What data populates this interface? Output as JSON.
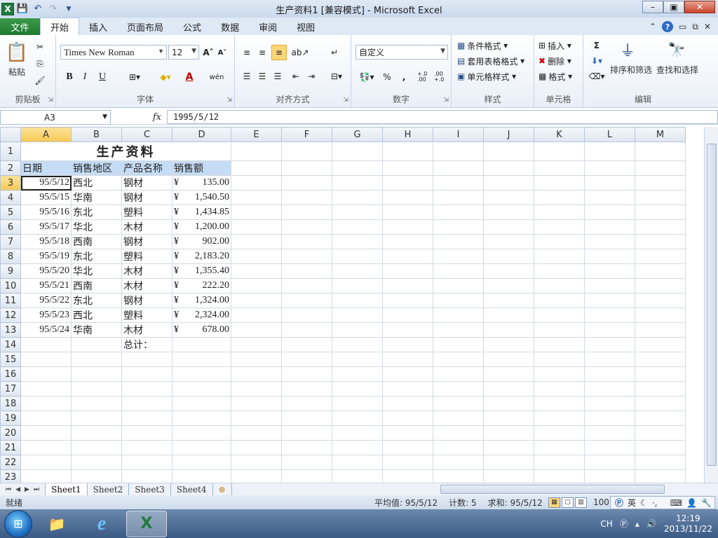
{
  "window": {
    "title": "生产资料1  [兼容模式]  -  Microsoft Excel",
    "logo": "X",
    "controls": {
      "minimize": "–",
      "maximize": "▣",
      "close": "✕"
    }
  },
  "ribbon_tabs": [
    "文件",
    "开始",
    "插入",
    "页面布局",
    "公式",
    "数据",
    "审阅",
    "视图"
  ],
  "ribbon": {
    "clipboard": {
      "label": "剪贴板",
      "paste": "粘贴"
    },
    "font": {
      "label": "字体",
      "name": "Times New Roman",
      "size": "12",
      "grow": "A˄",
      "shrink": "A˅",
      "bold": "B",
      "italic": "I",
      "underline": "U",
      "color_letter": "A",
      "wen": "wén"
    },
    "alignment": {
      "label": "对齐方式"
    },
    "number": {
      "label": "数字",
      "format": "自定义",
      "percent": "%",
      "comma": ",",
      "inc_dec": "+.0 .00",
      "dec_dec": ".00 +.0"
    },
    "styles": {
      "label": "样式",
      "conditional": "条件格式",
      "table_format": "套用表格格式",
      "cell_styles": "单元格样式"
    },
    "cells": {
      "label": "单元格",
      "insert": "插入",
      "delete": "删除",
      "format": "格式"
    },
    "editing": {
      "label": "编辑",
      "sigma": "Σ",
      "sort_filter": "排序和筛选",
      "find_select": "查找和选择"
    }
  },
  "formula_bar": {
    "name_box": "A3",
    "fx": "fx",
    "content": "1995/5/12"
  },
  "columns": [
    "A",
    "B",
    "C",
    "D",
    "E",
    "F",
    "G",
    "H",
    "I",
    "J",
    "K",
    "L",
    "M"
  ],
  "sheet": {
    "title": "生产资料",
    "headers": [
      "日期",
      "销售地区",
      "产品名称",
      "销售额"
    ],
    "currency": "¥",
    "rows": [
      [
        "95/5/12",
        "西北",
        "钢材",
        "135.00"
      ],
      [
        "95/5/15",
        "华南",
        "钢材",
        "1,540.50"
      ],
      [
        "95/5/16",
        "东北",
        "塑料",
        "1,434.85"
      ],
      [
        "95/5/17",
        "华北",
        "木材",
        "1,200.00"
      ],
      [
        "95/5/18",
        "西南",
        "钢材",
        "902.00"
      ],
      [
        "95/5/19",
        "东北",
        "塑料",
        "2,183.20"
      ],
      [
        "95/5/20",
        "华北",
        "木材",
        "1,355.40"
      ],
      [
        "95/5/21",
        "西南",
        "木材",
        "222.20"
      ],
      [
        "95/5/22",
        "东北",
        "钢材",
        "1,324.00"
      ],
      [
        "95/5/23",
        "西北",
        "塑料",
        "2,324.00"
      ],
      [
        "95/5/24",
        "华南",
        "木材",
        "678.00"
      ]
    ],
    "total_label": "总计：",
    "row_numbers": [
      "1",
      "2",
      "3",
      "4",
      "5",
      "6",
      "7",
      "8",
      "9",
      "10",
      "11",
      "12",
      "13",
      "14",
      "15",
      "16",
      "17",
      "18",
      "19",
      "20",
      "21",
      "22",
      "23"
    ]
  },
  "sheet_tabs": [
    "Sheet1",
    "Sheet2",
    "Sheet3",
    "Sheet4"
  ],
  "status": {
    "ready": "就绪",
    "average": "平均值: 95/5/12",
    "count": "计数: 5",
    "sum": "求和: 95/5/12",
    "zoom": "100",
    "ime_lang": "英"
  },
  "taskbar": {
    "tray_lang": "CH",
    "time": "12:19",
    "date": "2013/11/22"
  }
}
